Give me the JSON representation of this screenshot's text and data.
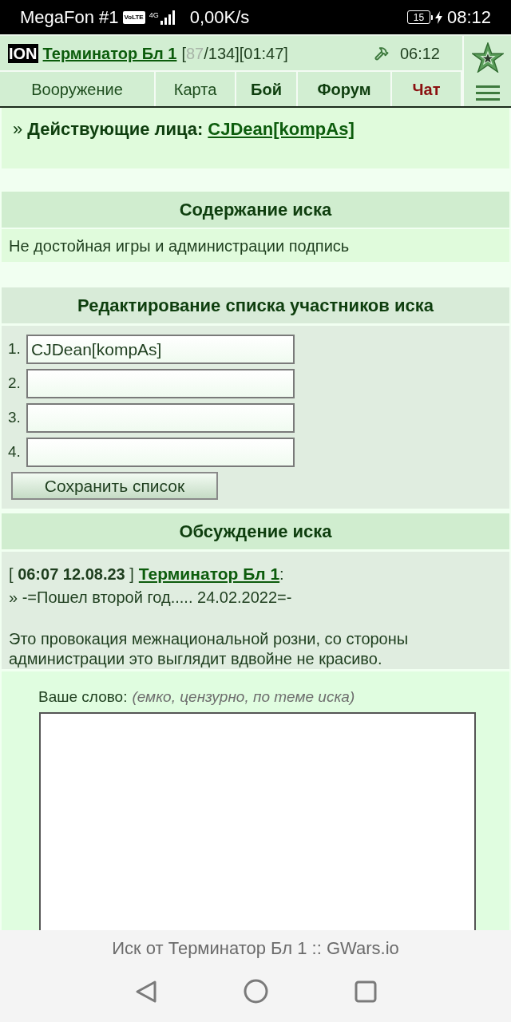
{
  "status_bar": {
    "carrier": "MegaFon #1",
    "volte": "VoLTE",
    "network": "4G",
    "speed": "0,00K/s",
    "battery": "15",
    "charging": true,
    "time": "08:12"
  },
  "header": {
    "logo": "ION",
    "player": "Терминатор Бл 1",
    "stats_open": "[",
    "hp": "87",
    "stats_rest": "/134][01:47]",
    "server_time": "06:12"
  },
  "nav": [
    {
      "label": "Вооружение",
      "kind": "plain"
    },
    {
      "label": "Карта",
      "kind": "plain"
    },
    {
      "label": "Бой",
      "kind": "bold"
    },
    {
      "label": "Форум",
      "kind": "bold"
    },
    {
      "label": "Чат",
      "kind": "alert"
    }
  ],
  "case_info": {
    "lead": "» **Действующие лица:**",
    "participant": "CJDean[kompAs]"
  },
  "claim": {
    "title": "Содержание иска",
    "text": "Не достойная игры и администрации подпись"
  },
  "editor": {
    "title": "Редактирование списка участников иска",
    "fields": [
      {
        "number": "1.",
        "value": "CJDean[kompAs]"
      },
      {
        "number": "2."
      },
      {
        "number": "3."
      },
      {
        "number": "4."
      }
    ],
    "save_button": "Сохранить список"
  },
  "discussion": {
    "title": "Обсуждение иска",
    "posts": [
      {
        "stamp": "[ **06:07 12.08.23** ]",
        "author": "Терминатор Бл 1",
        "after_author": ":",
        "paragraphs": [
          "» -=Пошел второй год..... 24.02.2022=-",
          "Это провокация межнациональной розни, со стороны администрации это выглядит вдвойне не красиво."
        ]
      }
    ]
  },
  "reply": {
    "label": "Ваше слово:",
    "hint": "(емко, цензурно, по теме иска)"
  },
  "browser": {
    "page_title": "Иск от Терминатор Бл 1 :: GWars.io"
  }
}
